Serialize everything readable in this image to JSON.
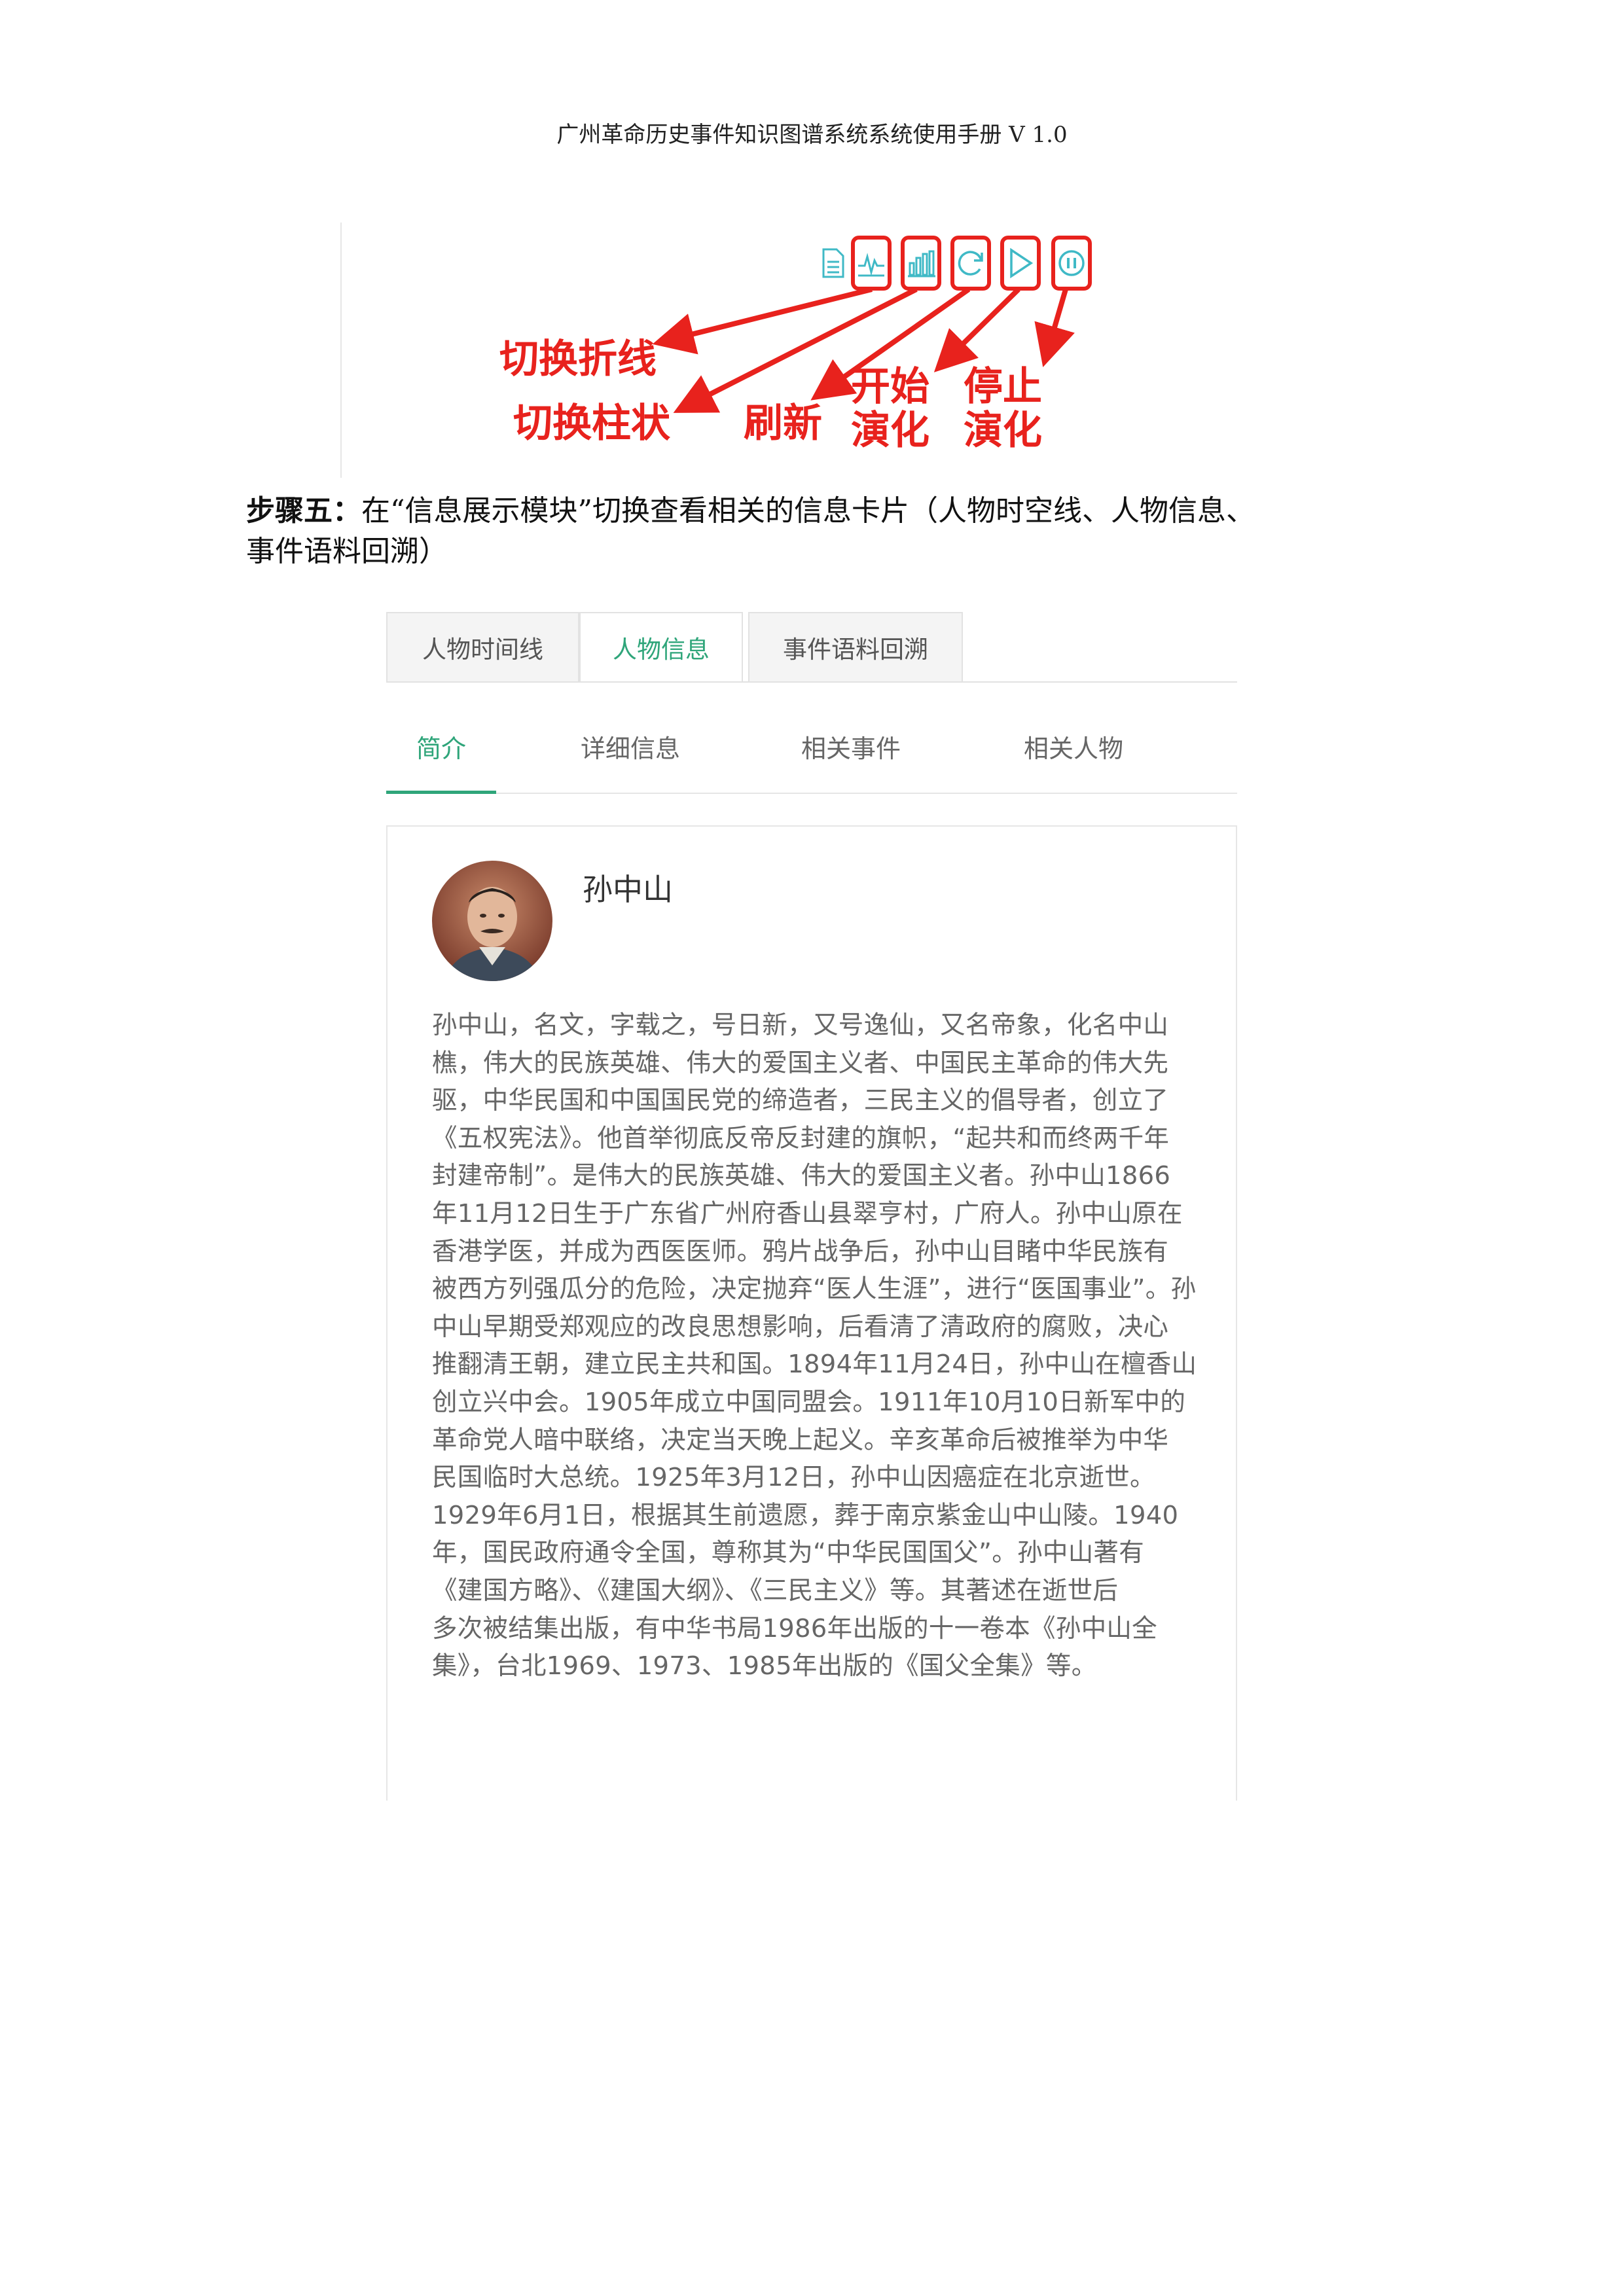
{
  "header": {
    "title": "广州革命历史事件知识图谱系统系统使用手册 V 1.0"
  },
  "toolbar": {
    "icons": [
      "document-icon",
      "line-chart-icon",
      "bar-chart-icon",
      "refresh-icon",
      "play-icon",
      "stop-icon"
    ],
    "accent_color": "#3fb9c6",
    "highlight_color": "#e8221d",
    "annotations": {
      "switch_line": "切换折线",
      "switch_bar": "切换柱状",
      "refresh": "刷新",
      "start_line1": "开始",
      "start_line2": "演化",
      "stop_line1": "停止",
      "stop_line2": "演化"
    }
  },
  "step": {
    "label": "步骤五：",
    "text_line1": "在“信息展示模块”切换查看相关的信息卡片（人物时空线、人物信息、",
    "text_line2": "事件语料回溯）"
  },
  "panel": {
    "card_tabs": [
      "人物时间线",
      "人物信息",
      "事件语料回溯"
    ],
    "active_card_tab": "人物信息",
    "sub_tabs": [
      "简介",
      "详细信息",
      "相关事件",
      "相关人物"
    ],
    "active_sub_tab": "简介",
    "accent_color": "#2fa57a",
    "person": {
      "name": "孙中山",
      "bio_lines": [
        "孙中山，名文，字载之，号日新，又号逸仙，又名帝象，化名中山",
        "樵，伟大的民族英雄、伟大的爱国主义者、中国民主革命的伟大先",
        "驱，中华民国和中国国民党的缔造者，三民主义的倡导者，创立了",
        "《五权宪法》。他首举彻底反帝反封建的旗帜，“起共和而终两千年",
        "封建帝制”。是伟大的民族英雄、伟大的爱国主义者。孙中山1866",
        "年11月12日生于广东省广州府香山县翠亨村，广府人。孙中山原在",
        "香港学医，并成为西医医师。鸦片战争后，孙中山目睹中华民族有",
        "被西方列强瓜分的危险，决定抛弃“医人生涯”，进行“医国事业”。孙",
        "中山早期受郑观应的改良思想影响，后看清了清政府的腐败，决心",
        "推翻清王朝，建立民主共和国。1894年11月24日，孙中山在檀香山",
        "创立兴中会。1905年成立中国同盟会。1911年10月10日新军中的",
        "革命党人暗中联络，决定当天晚上起义。辛亥革命后被推举为中华",
        "民国临时大总统。1925年3月12日，孙中山因癌症在北京逝世。",
        "1929年6月1日，根据其生前遗愿，葬于南京紫金山中山陵。1940",
        "年，国民政府通令全国，尊称其为“中华民国国父”。孙中山著有",
        "《建国方略》、《建国大纲》、《三民主义》等。其著述在逝世后",
        "多次被结集出版，有中华书局1986年出版的十一卷本《孙中山全",
        "集》，台北1969、1973、1985年出版的《国父全集》等。"
      ]
    }
  }
}
